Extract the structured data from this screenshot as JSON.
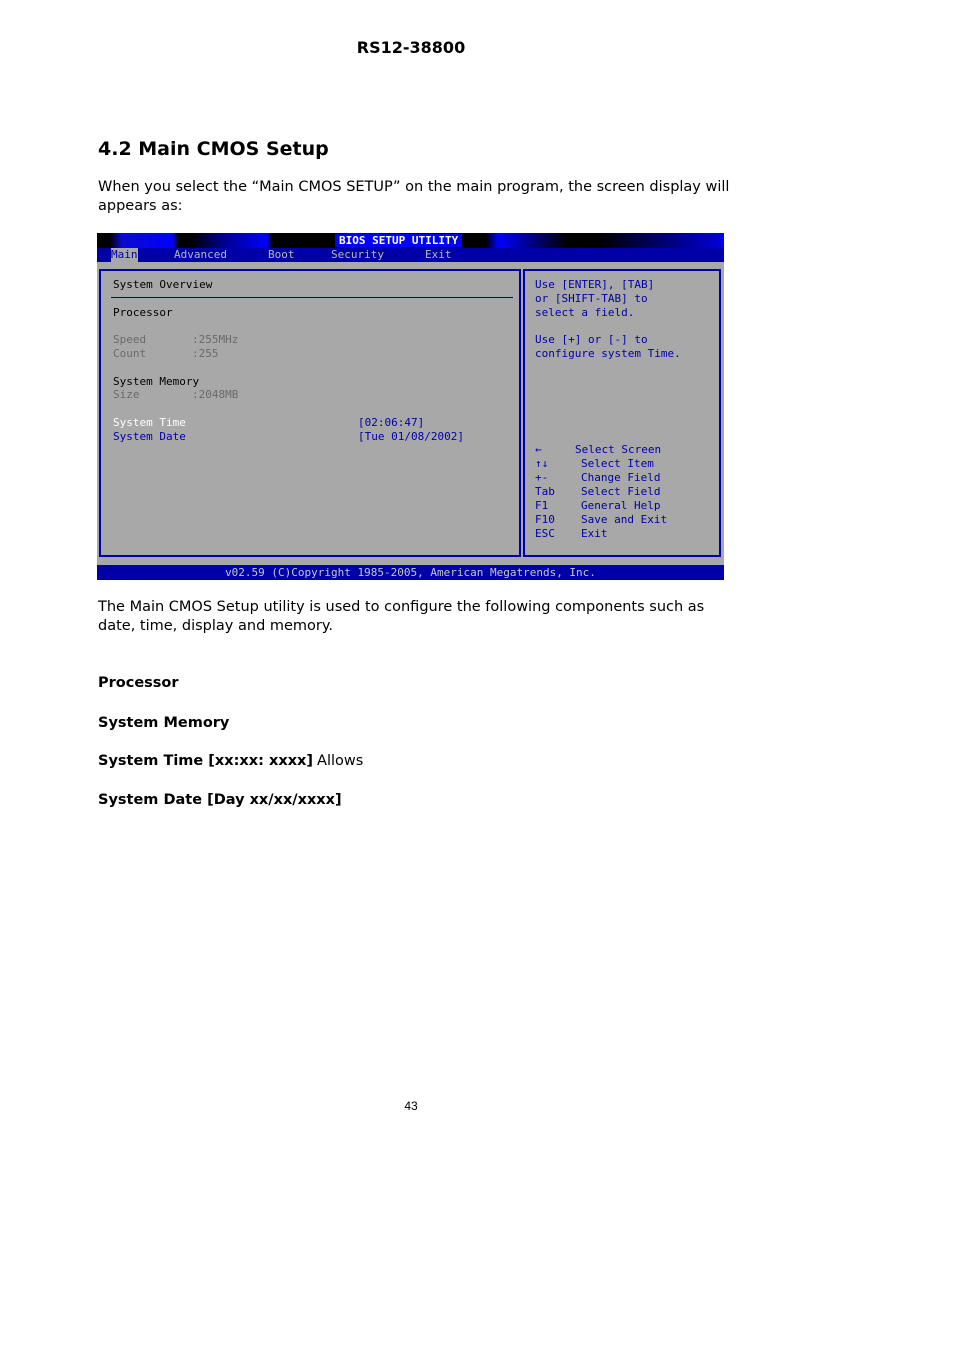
{
  "document": {
    "header_code": "RS12-38800",
    "section_title": "4.2 Main CMOS Setup",
    "intro": "When you select the “Main CMOS SETUP” on the main program, the screen display will appears as:",
    "description": "The Main CMOS Setup utility is used to configure the following components such as date, time, display and memory.",
    "terms": [
      {
        "label": "Processor",
        "desc": ""
      },
      {
        "label": "System Memory",
        "desc": ""
      },
      {
        "label": "System Time [xx:xx: xxxx]",
        "desc": "Allows"
      },
      {
        "label": "System Date [Day xx/xx/xxxx]",
        "desc": ""
      }
    ],
    "page_number": "43"
  },
  "bios": {
    "title": "BIOS SETUP UTILITY",
    "menu": [
      {
        "label": "Main",
        "active": true
      },
      {
        "label": "Advanced",
        "active": false
      },
      {
        "label": "Boot",
        "active": false
      },
      {
        "label": "Security",
        "active": false
      },
      {
        "label": "Exit",
        "active": false
      }
    ],
    "overview_title": "System Overview",
    "processor_heading": "Processor",
    "speed_label": "Speed",
    "speed_value": ":255MHz",
    "count_label": "Count",
    "count_value": ":255",
    "memory_heading": "System Memory",
    "size_label": "Size",
    "size_value": ":2048MB",
    "time_label": "System Time",
    "time_value": "[02:06:47]",
    "date_label": "System Date",
    "date_value": "[Tue 01/08/2002]",
    "help_lines": [
      "Use [ENTER], [TAB]",
      "or [SHIFT-TAB] to",
      "select a field.",
      "",
      "Use [+] or [-] to",
      "configure system Time."
    ],
    "hotkeys": [
      {
        "key": "←",
        "action": "Select Screen"
      },
      {
        "key": "↑↓",
        "action": "Select Item"
      },
      {
        "key": "+-",
        "action": "Change Field"
      },
      {
        "key": "Tab",
        "action": "Select Field"
      },
      {
        "key": "F1",
        "action": "General Help"
      },
      {
        "key": "F10",
        "action": "Save and Exit"
      },
      {
        "key": "ESC",
        "action": "Exit"
      }
    ],
    "footer": "v02.59 (C)Copyright 1985-2005, American Megatrends, Inc."
  }
}
